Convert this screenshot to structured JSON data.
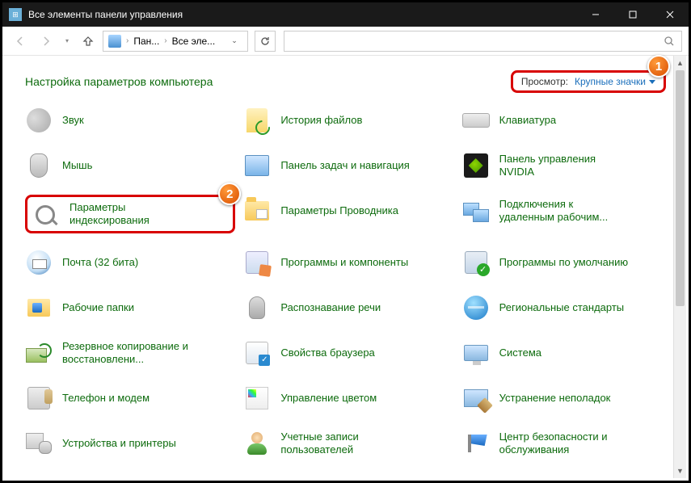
{
  "window": {
    "title": "Все элементы панели управления"
  },
  "breadcrumb": {
    "seg1": "Пан...",
    "seg2": "Все эле..."
  },
  "header": {
    "label": "Настройка параметров компьютера"
  },
  "view": {
    "label": "Просмотр:",
    "value": "Крупные значки"
  },
  "callouts": {
    "c1": "1",
    "c2": "2"
  },
  "items": {
    "r0c0": "Звук",
    "r0c1": "История файлов",
    "r0c2": "Клавиатура",
    "r1c0": "Мышь",
    "r1c1": "Панель задач и навигация",
    "r1c2": "Панель управления NVIDIA",
    "r2c0": "Параметры индексирования",
    "r2c1": "Параметры Проводника",
    "r2c2": "Подключения к удаленным рабочим...",
    "r3c0": "Почта (32 бита)",
    "r3c1": "Программы и компоненты",
    "r3c2": "Программы по умолчанию",
    "r4c0": "Рабочие папки",
    "r4c1": "Распознавание речи",
    "r4c2": "Региональные стандарты",
    "r5c0": "Резервное копирование и восстановлени...",
    "r5c1": "Свойства браузера",
    "r5c2": "Система",
    "r6c0": "Телефон и модем",
    "r6c1": "Управление цветом",
    "r6c2": "Устранение неполадок",
    "r7c0": "Устройства и принтеры",
    "r7c1": "Учетные записи пользователей",
    "r7c2": "Центр безопасности и обслуживания"
  }
}
